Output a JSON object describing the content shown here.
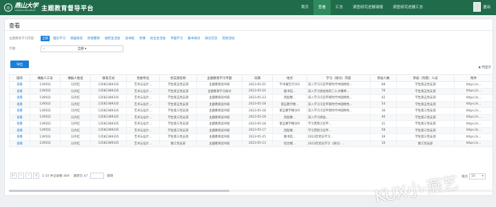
{
  "header": {
    "school_cn": "燕山大学",
    "school_en": "YANSHAN UNIVERSITY",
    "platform_title": "主题教育督导平台",
    "nav": [
      "首页",
      "查看",
      "汇总",
      "调查研究进展填报",
      "调查研究进展汇总"
    ],
    "active_nav_index": 1,
    "exit_label": "退出"
  },
  "page": {
    "title": "查看",
    "filter_label": "主题教育学习内容：",
    "filter_chips": [
      "全部",
      "理论学习",
      "调查研究",
      "检视整改",
      "组织生活会",
      "读书班",
      "党课",
      "民主生活会",
      "专题学习",
      "集中研讨",
      "研讨交流",
      "其他活动"
    ],
    "active_chip_index": 0,
    "term_label": "学期：",
    "term_value": "全部",
    "export_label": "导出",
    "columns_toggle": "列显示"
  },
  "table": {
    "headers": [
      "操作",
      "填报人工号",
      "填报人姓名",
      "联系方式",
      "党委单位",
      "党支部名称",
      "主题教育学习专题",
      "日期",
      "地点",
      "学习（研讨）内容",
      "参加人数",
      "参加（列席）人员",
      "附件"
    ],
    "rows": [
      [
        "查看",
        "139502",
        "冯丹红",
        "13582389335",
        "艺术与设计...",
        "学生第五党支部",
        "主题教育读书班",
        "2023-05-25",
        "学术报告厅201",
        "深入学习习近平新时代中国特色...",
        "68",
        "学生第五党支部",
        "https://s..."
      ],
      [
        "查看",
        "139502",
        "冯丹红",
        "13582389335",
        "艺术与设计...",
        "学生第五党支部",
        "主题教育学习研讨",
        "2023-05-24",
        "图书馆...",
        "深入学习领会党的二十大精神...",
        "76",
        "学生第五党支部",
        "https://s..."
      ],
      [
        "查看",
        "139502",
        "冯丹红",
        "13582389335",
        "艺术与设计...",
        "学生第五党支部",
        "主题教育读书班",
        "2023-05-23",
        "西配楼...",
        "深入学习习近平新时代中国特色...",
        "42",
        "学生第五党支部",
        "https://s..."
      ],
      [
        "查看",
        "139502",
        "冯丹红",
        "13582389335",
        "艺术与设计...",
        "学生第五党支部",
        "主题教育读书班",
        "2023-05-18",
        "第五教学楼...",
        "深入学习习近平新时代中国特色...",
        "54",
        "学生第五党支部",
        "https://s..."
      ],
      [
        "查看",
        "139502",
        "冯丹红",
        "13582389335",
        "艺术与设计...",
        "学生第三党支部",
        "主题教育读书班",
        "2023-05-18",
        "第五教学楼305",
        "深入学习习近平新时代中国特色...",
        "36",
        "学生第三党支部",
        "https://s..."
      ],
      [
        "查看",
        "139502",
        "冯丹红",
        "13582389335",
        "艺术与设计...",
        "学生第三党支部",
        "主题教育读书班",
        "2023-05-18",
        "西配楼...",
        "深入学习领会...",
        "40",
        "学生第三党支部",
        "https://s..."
      ],
      [
        "查看",
        "139502",
        "冯丹红",
        "13582389335",
        "艺术与设计...",
        "学生第三党支部",
        "主题教育读书班",
        "2023-05-18",
        "第五教学楼305",
        "学习贯彻习近平...",
        "31",
        "学生第三党支部",
        "https://s..."
      ],
      [
        "查看",
        "139502",
        "冯丹红",
        "13582389335",
        "艺术与设计...",
        "学生第三党支部",
        "主题教育读书班",
        "2023-05-17",
        "西配楼...",
        "学习贯彻习近平...",
        "58",
        "学生第三党支部",
        "https://s..."
      ],
      [
        "查看",
        "139502",
        "冯丹红",
        "13582389335",
        "艺术与设计...",
        "学生第三党支部",
        "主题教育读书班",
        "2023-05-25",
        "图书馆...",
        "2023年党员学习...",
        "39",
        "学生第三党支部",
        "https://s..."
      ],
      [
        "查看",
        "139502",
        "冯丹红",
        "13582389335",
        "艺术与设计...",
        "教工党支部",
        "主题教育读书班",
        "2023-05-13",
        "综合楼...",
        "2023年党员学习（研讨）...",
        "16",
        "教工党支部",
        "https://s..."
      ]
    ]
  },
  "pager": {
    "range_text": "1-10 共记录数 469",
    "page_label": "跳转页 47",
    "page_input": "",
    "go_label": "跳转",
    "page_size_label": "每页",
    "page_size": "10"
  },
  "watermark": "KUX小·燕艺"
}
